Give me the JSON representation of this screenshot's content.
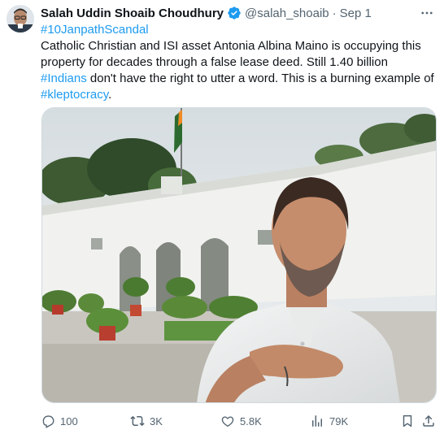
{
  "author": {
    "name": "Salah Uddin Shoaib Choudhury",
    "handle": "@salah_shoaib",
    "separator": "·",
    "date": "Sep 1",
    "avatar_icon": "avatar-photo",
    "verified_icon": "verified-badge-icon"
  },
  "tweet": {
    "hashtag1": "#10JanpathScandal",
    "text1": "Catholic Christian and ISI asset Antonia Albina Maino is occupying this property for decades through a false lease deed. Still 1.40 billion ",
    "hashtag2": "#Indians",
    "text2": " don't have the right to utter a word. This is a burning example of ",
    "hashtag3": "#kleptocracy",
    "text3": "."
  },
  "media": {
    "description_icon": "photo-man-in-front-of-white-building"
  },
  "actions": {
    "replies": "100",
    "reposts": "3K",
    "likes": "5.8K",
    "views": "79K"
  },
  "colors": {
    "accent": "#1d9bf0",
    "text": "#0f1419",
    "muted": "#536471",
    "border": "#cfd9de"
  }
}
